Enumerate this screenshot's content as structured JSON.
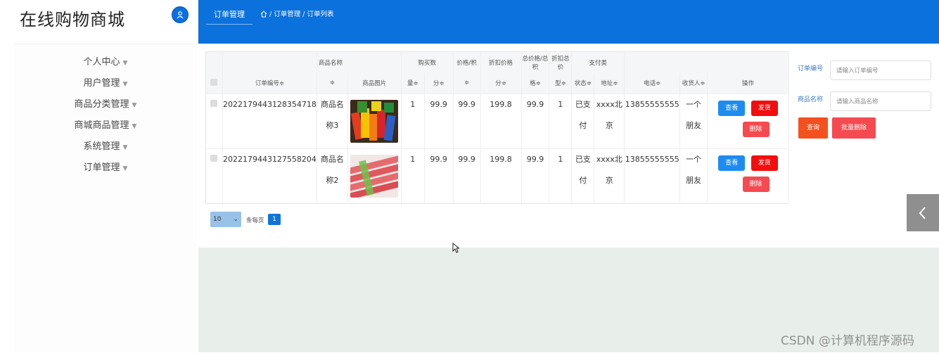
{
  "app": {
    "title": "在线购物商城"
  },
  "sidebar": {
    "items": [
      {
        "label": "个人中心"
      },
      {
        "label": "用户管理"
      },
      {
        "label": "商品分类管理"
      },
      {
        "label": "商城商品管理"
      },
      {
        "label": "系统管理"
      },
      {
        "label": "订单管理"
      }
    ]
  },
  "header": {
    "active_tab": "订单管理",
    "breadcrumb": "/ 订单管理 / 订单列表"
  },
  "table": {
    "header_top": [
      "商品名称",
      "购买数",
      "价格/积",
      "折扣价格",
      "总价格/总积",
      "折扣总价",
      "支付类"
    ],
    "header_bottom": [
      "订单编号≑",
      "≑",
      "商品图片",
      "量≑",
      "分≑",
      "≑",
      "分≑",
      "格≑",
      "型≑",
      "状态≑",
      "地址≑",
      "电话≑",
      "收货人≑",
      "操作"
    ],
    "rows": [
      {
        "order_no": "2022179443128354718",
        "product_name_1": "商品名",
        "product_name_2": "称3",
        "qty": "1",
        "price": "99.9",
        "discount_price": "99.9",
        "total": "199.8",
        "discount_total": "99.9",
        "pay_type": "1",
        "status_1": "已支",
        "status_2": "付",
        "address_1": "xxxx北",
        "address_2": "京",
        "phone": "13855555555",
        "receiver_1": "一个",
        "receiver_2": "朋友"
      },
      {
        "order_no": "2022179443127558204",
        "product_name_1": "商品名",
        "product_name_2": "称2",
        "qty": "1",
        "price": "99.9",
        "discount_price": "99.9",
        "total": "199.8",
        "discount_total": "99.9",
        "pay_type": "1",
        "status_1": "已支",
        "status_2": "付",
        "address_1": "xxxx北",
        "address_2": "京",
        "phone": "13855555555",
        "receiver_1": "一个",
        "receiver_2": "朋友"
      }
    ],
    "actions": {
      "view": "查看",
      "ship": "发货",
      "delete": "删除"
    }
  },
  "search": {
    "order_label": "订单编号",
    "order_placeholder": "请输入订单编号",
    "product_label": "商品名称",
    "product_placeholder": "请输入商品名称",
    "query_button": "查询",
    "batch_delete_button": "批量删除"
  },
  "pagination": {
    "page_size": "10",
    "per_page_label": "条每页",
    "current_page": "1"
  },
  "watermark": "CSDN @计算机程序源码",
  "colors": {
    "header_blue": "#0b71dc",
    "btn_view": "#1e8bf0",
    "btn_ship": "#f50d0d",
    "btn_delete": "#f54a50",
    "btn_query": "#f4511e"
  }
}
